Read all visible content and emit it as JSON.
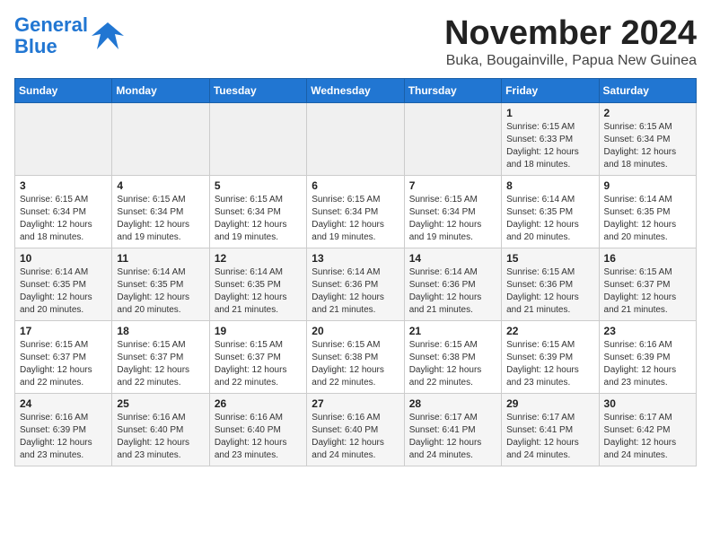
{
  "header": {
    "logo_line1": "General",
    "logo_line2": "Blue",
    "title": "November 2024",
    "subtitle": "Buka, Bougainville, Papua New Guinea"
  },
  "weekdays": [
    "Sunday",
    "Monday",
    "Tuesday",
    "Wednesday",
    "Thursday",
    "Friday",
    "Saturday"
  ],
  "weeks": [
    [
      {
        "day": "",
        "info": ""
      },
      {
        "day": "",
        "info": ""
      },
      {
        "day": "",
        "info": ""
      },
      {
        "day": "",
        "info": ""
      },
      {
        "day": "",
        "info": ""
      },
      {
        "day": "1",
        "info": "Sunrise: 6:15 AM\nSunset: 6:33 PM\nDaylight: 12 hours\nand 18 minutes."
      },
      {
        "day": "2",
        "info": "Sunrise: 6:15 AM\nSunset: 6:34 PM\nDaylight: 12 hours\nand 18 minutes."
      }
    ],
    [
      {
        "day": "3",
        "info": "Sunrise: 6:15 AM\nSunset: 6:34 PM\nDaylight: 12 hours\nand 18 minutes."
      },
      {
        "day": "4",
        "info": "Sunrise: 6:15 AM\nSunset: 6:34 PM\nDaylight: 12 hours\nand 19 minutes."
      },
      {
        "day": "5",
        "info": "Sunrise: 6:15 AM\nSunset: 6:34 PM\nDaylight: 12 hours\nand 19 minutes."
      },
      {
        "day": "6",
        "info": "Sunrise: 6:15 AM\nSunset: 6:34 PM\nDaylight: 12 hours\nand 19 minutes."
      },
      {
        "day": "7",
        "info": "Sunrise: 6:15 AM\nSunset: 6:34 PM\nDaylight: 12 hours\nand 19 minutes."
      },
      {
        "day": "8",
        "info": "Sunrise: 6:14 AM\nSunset: 6:35 PM\nDaylight: 12 hours\nand 20 minutes."
      },
      {
        "day": "9",
        "info": "Sunrise: 6:14 AM\nSunset: 6:35 PM\nDaylight: 12 hours\nand 20 minutes."
      }
    ],
    [
      {
        "day": "10",
        "info": "Sunrise: 6:14 AM\nSunset: 6:35 PM\nDaylight: 12 hours\nand 20 minutes."
      },
      {
        "day": "11",
        "info": "Sunrise: 6:14 AM\nSunset: 6:35 PM\nDaylight: 12 hours\nand 20 minutes."
      },
      {
        "day": "12",
        "info": "Sunrise: 6:14 AM\nSunset: 6:35 PM\nDaylight: 12 hours\nand 21 minutes."
      },
      {
        "day": "13",
        "info": "Sunrise: 6:14 AM\nSunset: 6:36 PM\nDaylight: 12 hours\nand 21 minutes."
      },
      {
        "day": "14",
        "info": "Sunrise: 6:14 AM\nSunset: 6:36 PM\nDaylight: 12 hours\nand 21 minutes."
      },
      {
        "day": "15",
        "info": "Sunrise: 6:15 AM\nSunset: 6:36 PM\nDaylight: 12 hours\nand 21 minutes."
      },
      {
        "day": "16",
        "info": "Sunrise: 6:15 AM\nSunset: 6:37 PM\nDaylight: 12 hours\nand 21 minutes."
      }
    ],
    [
      {
        "day": "17",
        "info": "Sunrise: 6:15 AM\nSunset: 6:37 PM\nDaylight: 12 hours\nand 22 minutes."
      },
      {
        "day": "18",
        "info": "Sunrise: 6:15 AM\nSunset: 6:37 PM\nDaylight: 12 hours\nand 22 minutes."
      },
      {
        "day": "19",
        "info": "Sunrise: 6:15 AM\nSunset: 6:37 PM\nDaylight: 12 hours\nand 22 minutes."
      },
      {
        "day": "20",
        "info": "Sunrise: 6:15 AM\nSunset: 6:38 PM\nDaylight: 12 hours\nand 22 minutes."
      },
      {
        "day": "21",
        "info": "Sunrise: 6:15 AM\nSunset: 6:38 PM\nDaylight: 12 hours\nand 22 minutes."
      },
      {
        "day": "22",
        "info": "Sunrise: 6:15 AM\nSunset: 6:39 PM\nDaylight: 12 hours\nand 23 minutes."
      },
      {
        "day": "23",
        "info": "Sunrise: 6:16 AM\nSunset: 6:39 PM\nDaylight: 12 hours\nand 23 minutes."
      }
    ],
    [
      {
        "day": "24",
        "info": "Sunrise: 6:16 AM\nSunset: 6:39 PM\nDaylight: 12 hours\nand 23 minutes."
      },
      {
        "day": "25",
        "info": "Sunrise: 6:16 AM\nSunset: 6:40 PM\nDaylight: 12 hours\nand 23 minutes."
      },
      {
        "day": "26",
        "info": "Sunrise: 6:16 AM\nSunset: 6:40 PM\nDaylight: 12 hours\nand 23 minutes."
      },
      {
        "day": "27",
        "info": "Sunrise: 6:16 AM\nSunset: 6:40 PM\nDaylight: 12 hours\nand 24 minutes."
      },
      {
        "day": "28",
        "info": "Sunrise: 6:17 AM\nSunset: 6:41 PM\nDaylight: 12 hours\nand 24 minutes."
      },
      {
        "day": "29",
        "info": "Sunrise: 6:17 AM\nSunset: 6:41 PM\nDaylight: 12 hours\nand 24 minutes."
      },
      {
        "day": "30",
        "info": "Sunrise: 6:17 AM\nSunset: 6:42 PM\nDaylight: 12 hours\nand 24 minutes."
      }
    ]
  ]
}
